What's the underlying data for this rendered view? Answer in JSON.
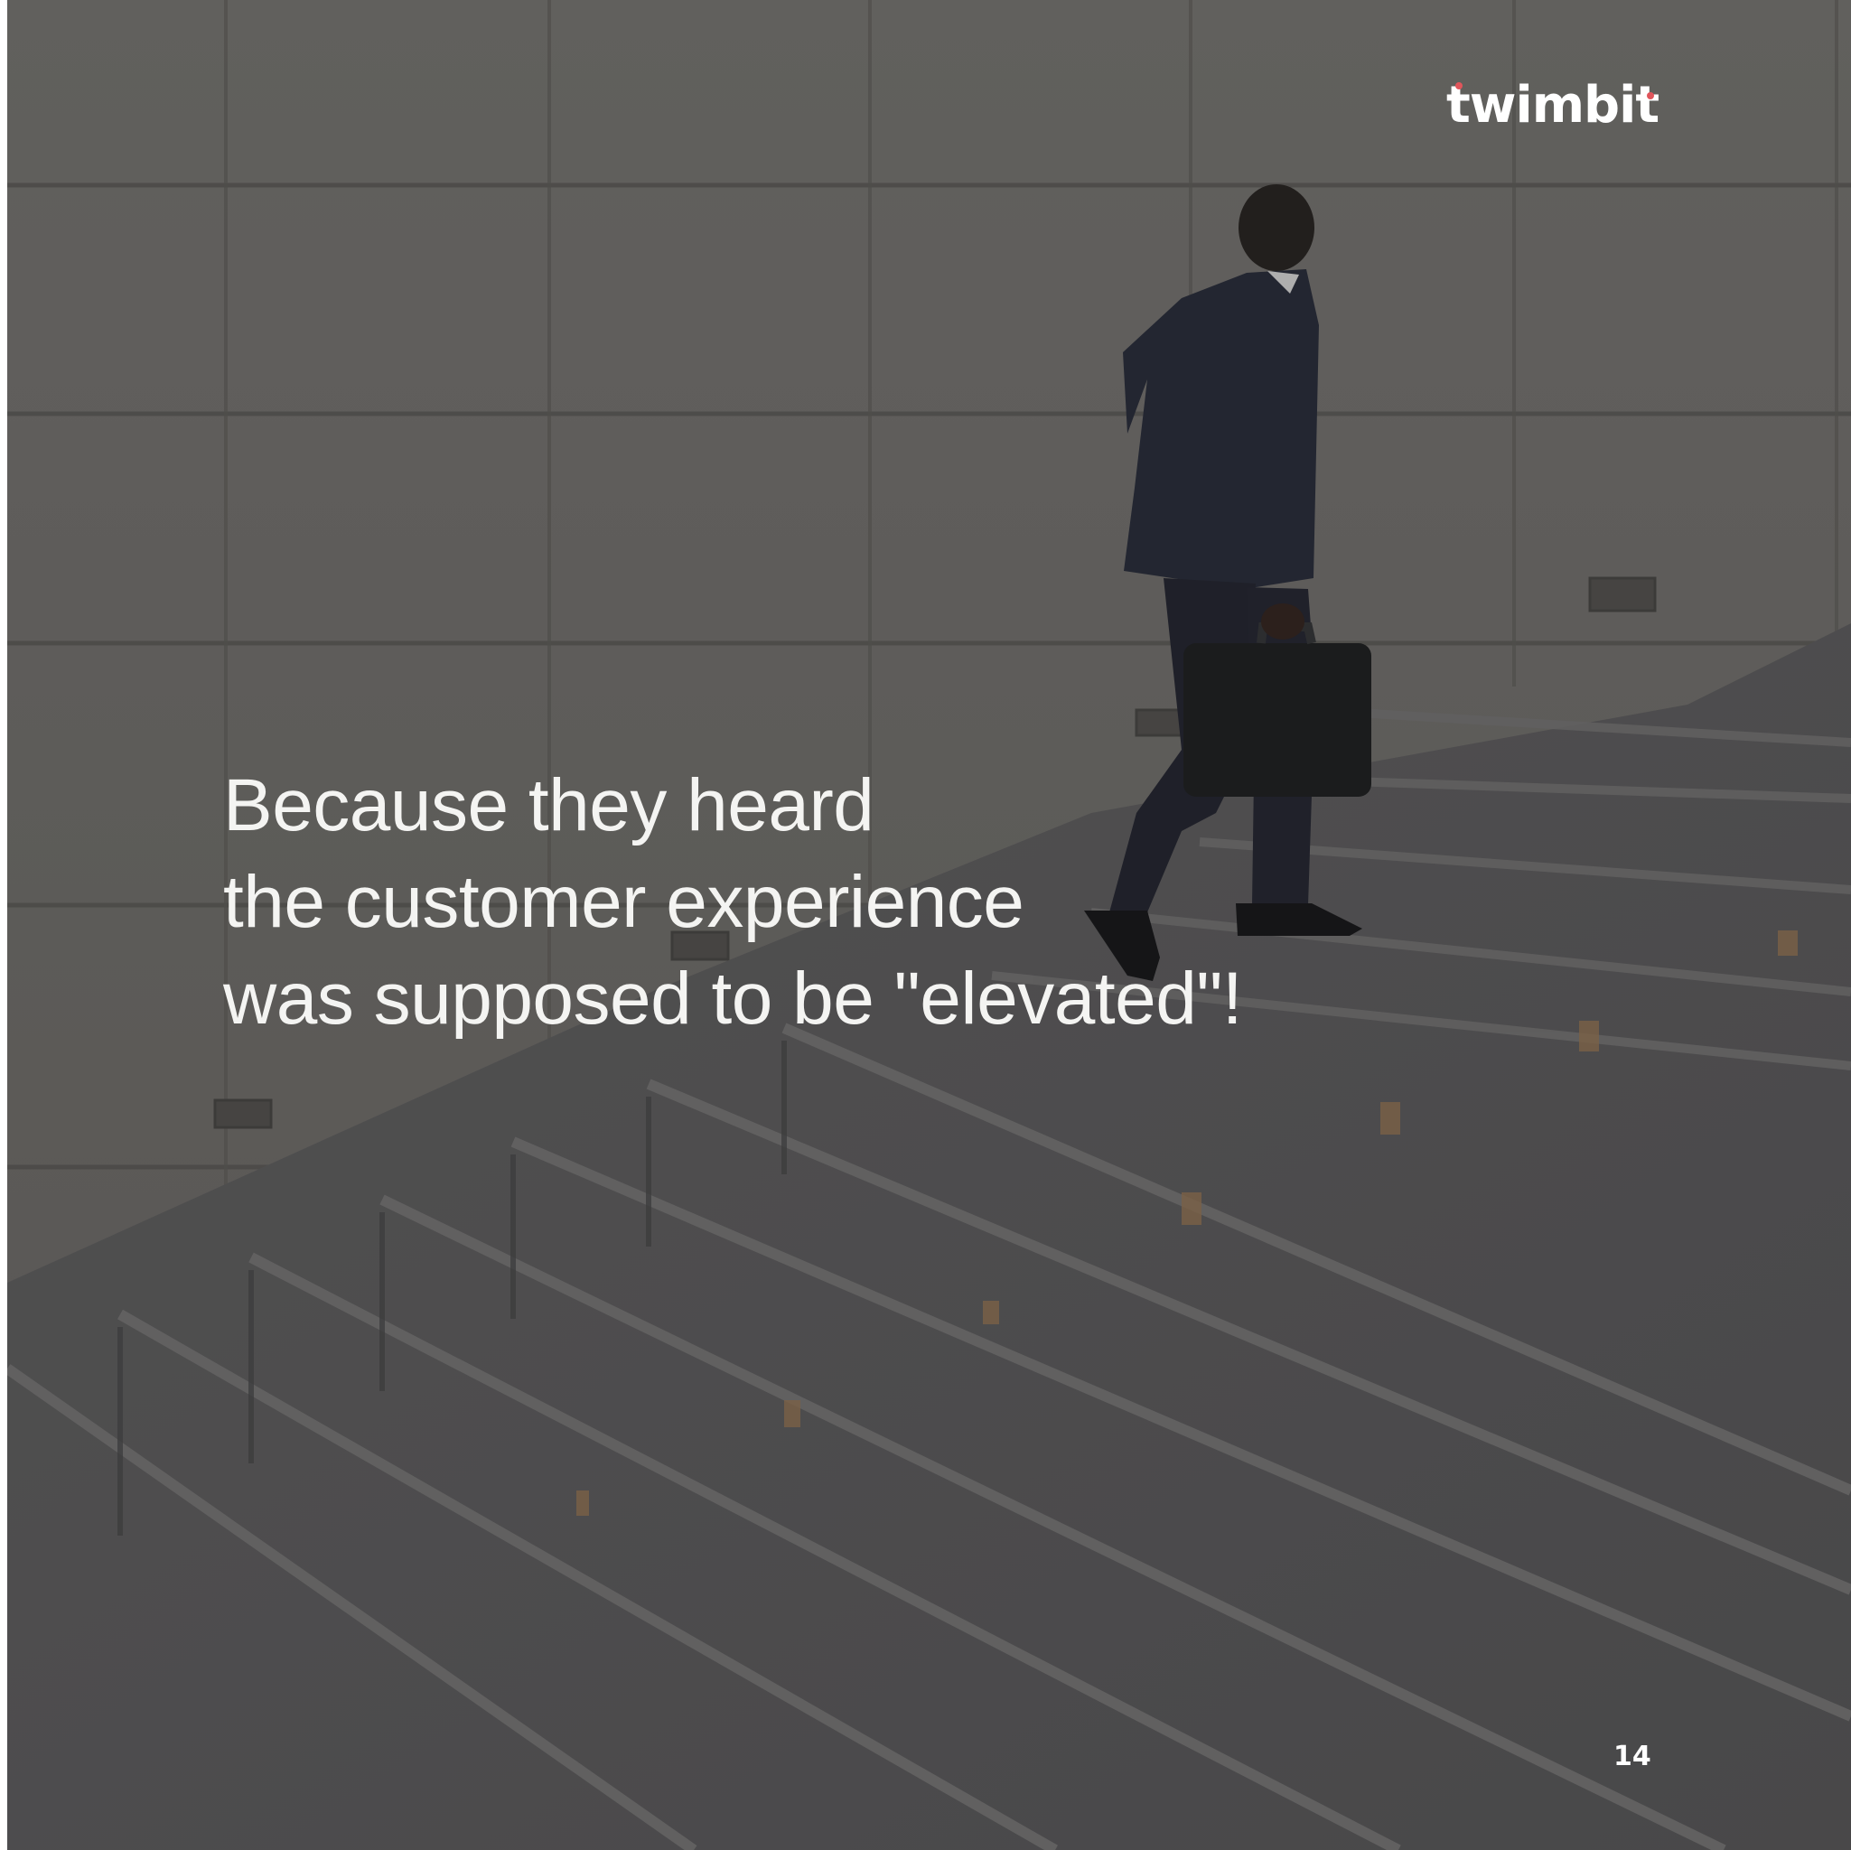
{
  "brand": {
    "logo_text": "twimbit",
    "accent_color": "#e0555b"
  },
  "slide": {
    "headline_lines": [
      "Because they heard",
      "the customer experience",
      "was supposed to be \"elevated\"!"
    ],
    "page_number": "14"
  },
  "background": {
    "description_icon": "man-climbing-stairs-photo"
  }
}
